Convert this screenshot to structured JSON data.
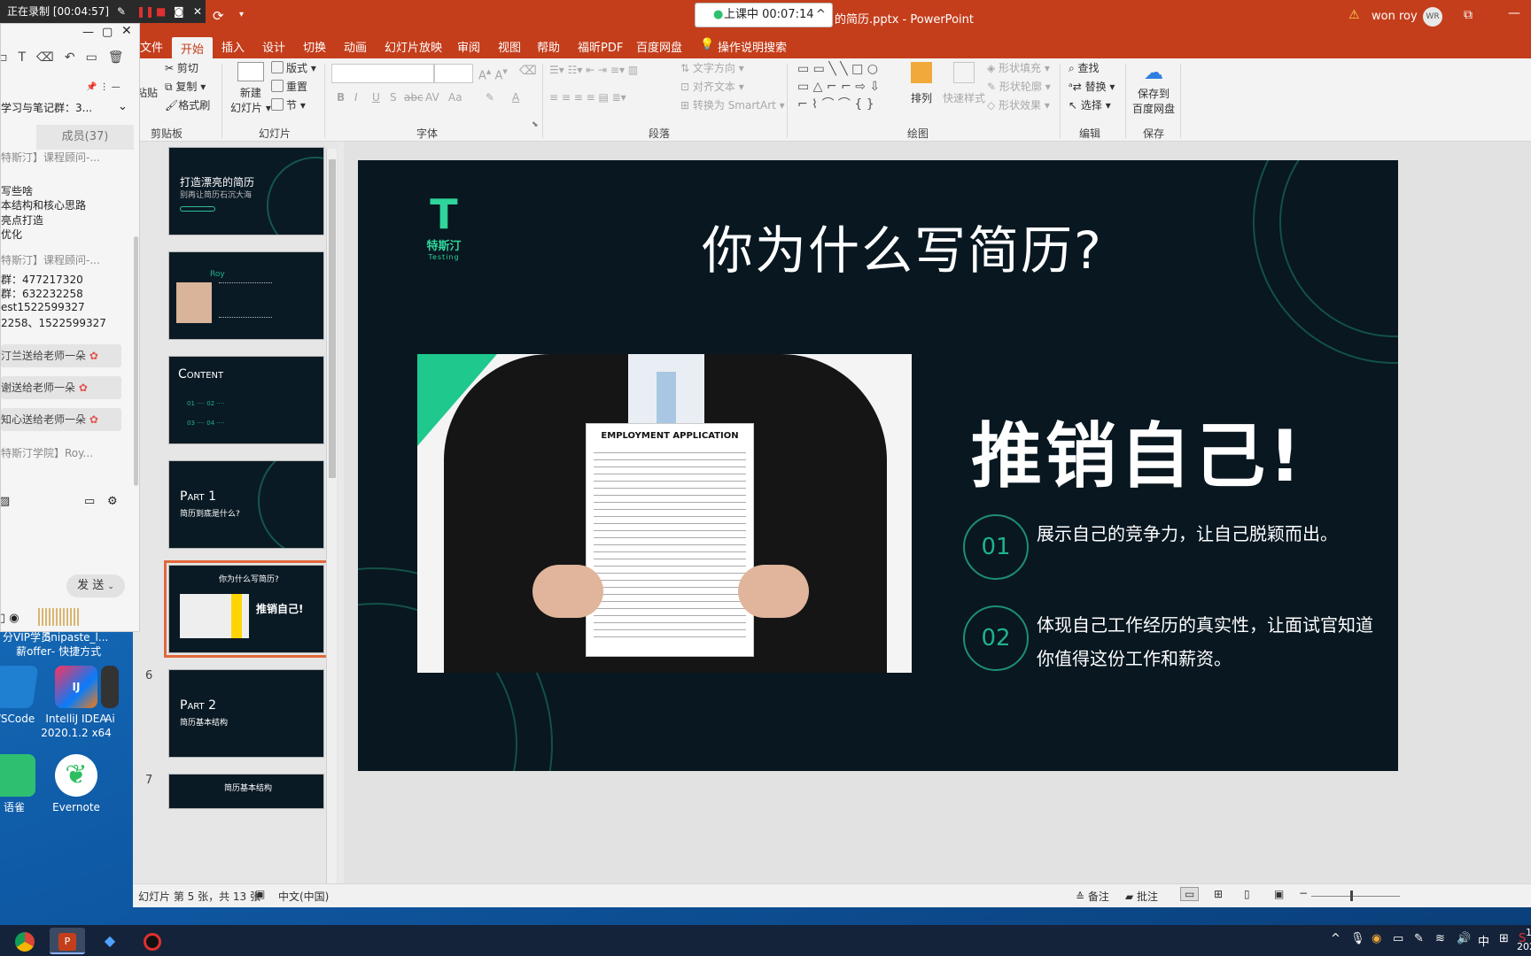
{
  "recording": {
    "text": "正在录制 [00:04:57]"
  },
  "class_timer": {
    "text": "上课中 00:07:14"
  },
  "window": {
    "title": "的简历.pptx  -  PowerPoint",
    "user": "won roy",
    "user_initials": "WR"
  },
  "ribbon_tabs": [
    "文件",
    "开始",
    "插入",
    "设计",
    "切换",
    "动画",
    "幻灯片放映",
    "审阅",
    "视图",
    "帮助",
    "福昕PDF",
    "百度网盘",
    "操作说明搜索"
  ],
  "ribbon": {
    "clipboard": {
      "paste": "粘贴",
      "cut": "剪切",
      "copy": "复制",
      "format_painter": "格式刷",
      "label": "剪贴板"
    },
    "slides": {
      "new_slide": "新建",
      "new_slide2": "幻灯片",
      "layout": "版式",
      "reset": "重置",
      "section": "节",
      "label": "幻灯片"
    },
    "font": {
      "label": "字体",
      "bold": "B",
      "italic": "I",
      "underline": "U",
      "shadow": "S",
      "strike": "abc",
      "spacing": "AV",
      "case": "Aa",
      "color": "A"
    },
    "paragraph": {
      "text_direction": "文字方向",
      "align_text": "对齐文本",
      "smartart": "转换为 SmartArt",
      "label": "段落"
    },
    "drawing": {
      "arrange": "排列",
      "quick_styles": "快速样式",
      "fill": "形状填充",
      "outline": "形状轮廓",
      "effects": "形状效果",
      "label": "绘图"
    },
    "editing": {
      "find": "查找",
      "replace": "替换",
      "select": "选择",
      "label": "编辑"
    },
    "save": {
      "label1": "保存到",
      "label2": "百度网盘",
      "group": "保存"
    }
  },
  "thumbnails": [
    {
      "num": "",
      "title": "打造漂亮的简历",
      "sub": "别再让简历石沉大海"
    },
    {
      "num": "",
      "title": "Roy",
      "sub": ""
    },
    {
      "num": "",
      "title": "Content",
      "sub": ""
    },
    {
      "num": "",
      "title": "Part 1",
      "sub": "简历到底是什么?"
    },
    {
      "num": "",
      "title": "你为什么写简历?",
      "sub": "推销自己!"
    },
    {
      "num": "6",
      "title": "Part 2",
      "sub": "简历基本结构"
    },
    {
      "num": "7",
      "title": "简历基本结构",
      "sub": ""
    }
  ],
  "slide": {
    "logo_brand": "特斯汀",
    "logo_sub": "Testing",
    "title": "你为什么写简历?",
    "headline": "推销自己!",
    "doc_title": "EMPLOYMENT APPLICATION",
    "points": [
      {
        "num": "01",
        "text": "展示自己的竞争力，让自己脱颖而出。"
      },
      {
        "num": "02",
        "text": "体现自己工作经历的真实性，让面试官知道你值得这份工作和薪资。"
      }
    ]
  },
  "status": {
    "slide_info": "幻灯片 第 5 张，共 13 张",
    "language": "中文(中国)",
    "notes": "备注",
    "comments": "批注"
  },
  "chat": {
    "group_name": "学习与笔记群：3...",
    "members": "成员(37)",
    "lines": [
      "特斯汀】课程顾问-...",
      "写些啥",
      "本结构和核心思路",
      "亮点打造",
      "优化",
      "特斯汀】课程顾问-...",
      "群：477217320",
      "群：632232258",
      "est1522599327",
      "2258、1522599327"
    ],
    "gifts": [
      "汀兰送给老师一朵",
      "谢送给老师一朵",
      "知心送给老师一朵"
    ],
    "last": "特斯汀学院】Roy...",
    "send": "发 送"
  },
  "desktop_icons": [
    {
      "label": "分VIP学员\n薪offer"
    },
    {
      "label": "Snipaste_l...\n- 快捷方式"
    },
    {
      "label": "VSCode"
    },
    {
      "label": "IntelliJ IDEA\n2020.1.2 x64"
    },
    {
      "label": "Ai"
    },
    {
      "label": "语雀"
    },
    {
      "label": "Evernote"
    }
  ],
  "tray": {
    "ime": "中",
    "time": "1",
    "date": "202"
  }
}
